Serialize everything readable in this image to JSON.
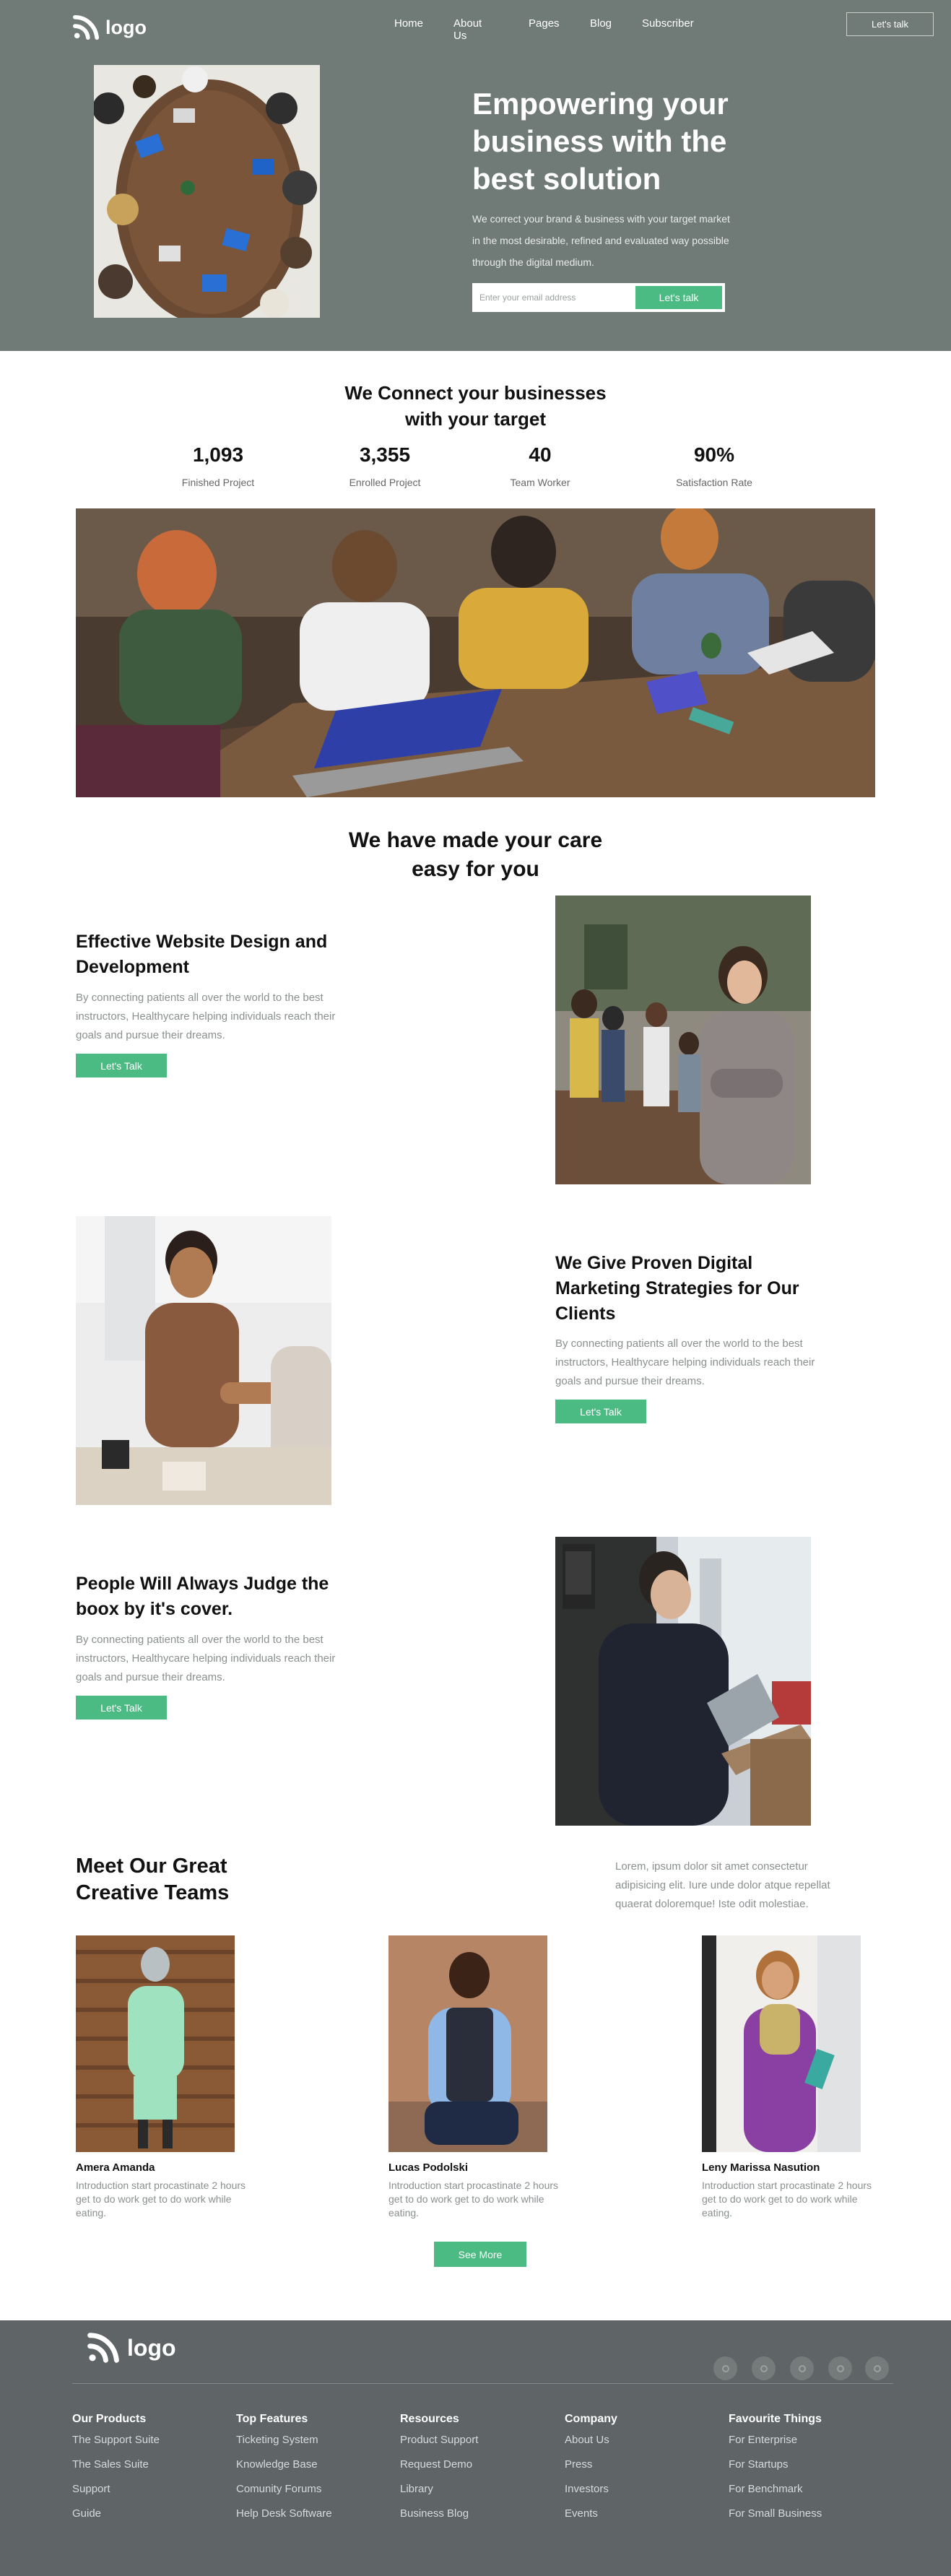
{
  "brand": {
    "logo_text": "logo"
  },
  "nav": {
    "items": [
      "Home",
      "About Us",
      "Pages",
      "Blog",
      "Subscriber"
    ],
    "cta": "Let's talk"
  },
  "hero": {
    "title": "Empowering your business with the best solution",
    "text": "We correct your brand & business with your target market in the most desirable, refined and evaluated way possible through the digital medium.",
    "email_placeholder": "Enter your email address",
    "email_button": "Let's talk"
  },
  "connect": {
    "title_line1": "We Connect your businesses",
    "title_line2": "with your target",
    "stats": [
      {
        "value": "1,093",
        "label": "Finished Project"
      },
      {
        "value": "3,355",
        "label": "Enrolled Project"
      },
      {
        "value": "40",
        "label": "Team Worker"
      },
      {
        "value": "90%",
        "label": "Satisfaction Rate"
      }
    ]
  },
  "care": {
    "title_line1": "We have made your care",
    "title_line2": "easy for you"
  },
  "features": [
    {
      "title": "Effective Website Design and Development",
      "text": "By connecting patients all over the world to the best instructors, Healthycare helping individuals reach their goals and pursue their dreams.",
      "button": "Let's Talk"
    },
    {
      "title": "We Give Proven Digital Marketing Strategies for Our Clients",
      "text": "By connecting patients all over the world to the best instructors, Healthycare helping individuals reach their goals and pursue their dreams.",
      "button": "Let's Talk"
    },
    {
      "title": "People Will Always Judge the boox by it's cover.",
      "text": "By connecting patients all over the world to the best instructors, Healthycare helping individuals reach their goals and pursue their dreams.",
      "button": "Let's Talk"
    }
  ],
  "team": {
    "title": "Meet Our Great Creative Teams",
    "intro": "Lorem, ipsum dolor sit amet consectetur adipisicing elit. Iure unde dolor atque repellat quaerat doloremque! Iste odit molestiae.",
    "members": [
      {
        "name": "Amera Amanda",
        "desc": "Introduction start procastinate 2 hours get to do work get to do work while eating."
      },
      {
        "name": "Lucas Podolski",
        "desc": "Introduction start procastinate 2 hours get to do work get to do work while eating."
      },
      {
        "name": "Leny Marissa Nasution",
        "desc": "Introduction start procastinate 2 hours get to do work get to do work while eating."
      }
    ],
    "see_more": "See More"
  },
  "footer": {
    "logo_text": "logo",
    "social_icons": [
      "social-icon-1",
      "social-icon-2",
      "social-icon-3",
      "social-icon-4",
      "social-icon-5"
    ],
    "columns": [
      {
        "heading": "Our Products",
        "links": [
          "The Support Suite",
          "The Sales Suite",
          "Support",
          "Guide"
        ]
      },
      {
        "heading": "Top Features",
        "links": [
          "Ticketing System",
          "Knowledge Base",
          "Comunity Forums",
          "Help Desk Software"
        ]
      },
      {
        "heading": "Resources",
        "links": [
          "Product Support",
          "Request Demo",
          "Library",
          "Business Blog"
        ]
      },
      {
        "heading": "Company",
        "links": [
          "About Us",
          "Press",
          "Investors",
          "Events"
        ]
      },
      {
        "heading": "Favourite Things",
        "links": [
          "For Enterprise",
          "For Startups",
          "For Benchmark",
          "For Small Business"
        ]
      }
    ]
  },
  "colors": {
    "hero_bg": "#707a77",
    "accent": "#4bba83",
    "footer_bg": "#5f6566"
  }
}
